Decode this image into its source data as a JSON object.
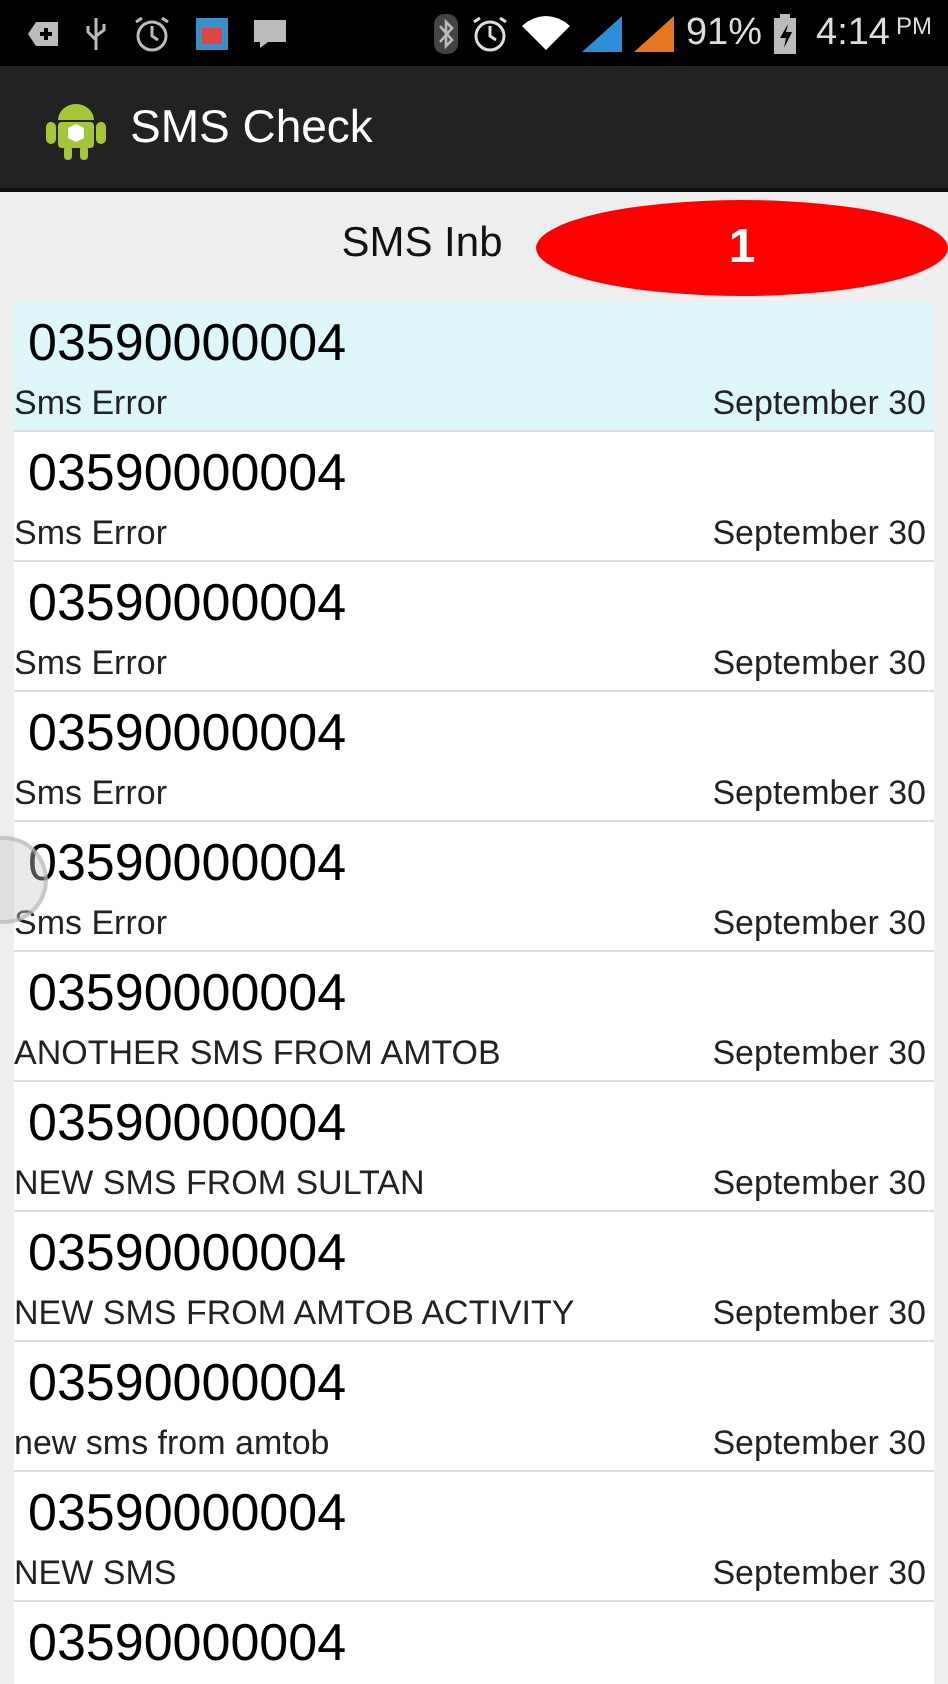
{
  "status_bar": {
    "battery": "91%",
    "time": "4:14",
    "ampm": "PM"
  },
  "app_bar": {
    "title": "SMS Check"
  },
  "header": {
    "title": "SMS Inb",
    "badge": "1"
  },
  "messages": [
    {
      "number": "03590000004",
      "text": "Sms Error",
      "date": "September 30",
      "selected": true
    },
    {
      "number": "03590000004",
      "text": "Sms Error",
      "date": "September 30",
      "selected": false
    },
    {
      "number": "03590000004",
      "text": "Sms Error",
      "date": "September 30",
      "selected": false
    },
    {
      "number": "03590000004",
      "text": "Sms Error",
      "date": "September 30",
      "selected": false
    },
    {
      "number": "03590000004",
      "text": "Sms Error",
      "date": "September 30",
      "selected": false
    },
    {
      "number": "03590000004",
      "text": "ANOTHER SMS FROM AMTOB",
      "date": "September 30",
      "selected": false
    },
    {
      "number": "03590000004",
      "text": "NEW SMS FROM SULTAN",
      "date": "September 30",
      "selected": false
    },
    {
      "number": "03590000004",
      "text": "NEW SMS FROM AMTOB ACTIVITY",
      "date": "September 30",
      "selected": false
    },
    {
      "number": "03590000004",
      "text": "new sms from amtob",
      "date": "September 30",
      "selected": false
    },
    {
      "number": "03590000004",
      "text": "NEW SMS",
      "date": "September 30",
      "selected": false
    },
    {
      "number": "03590000004",
      "selected": false
    }
  ]
}
